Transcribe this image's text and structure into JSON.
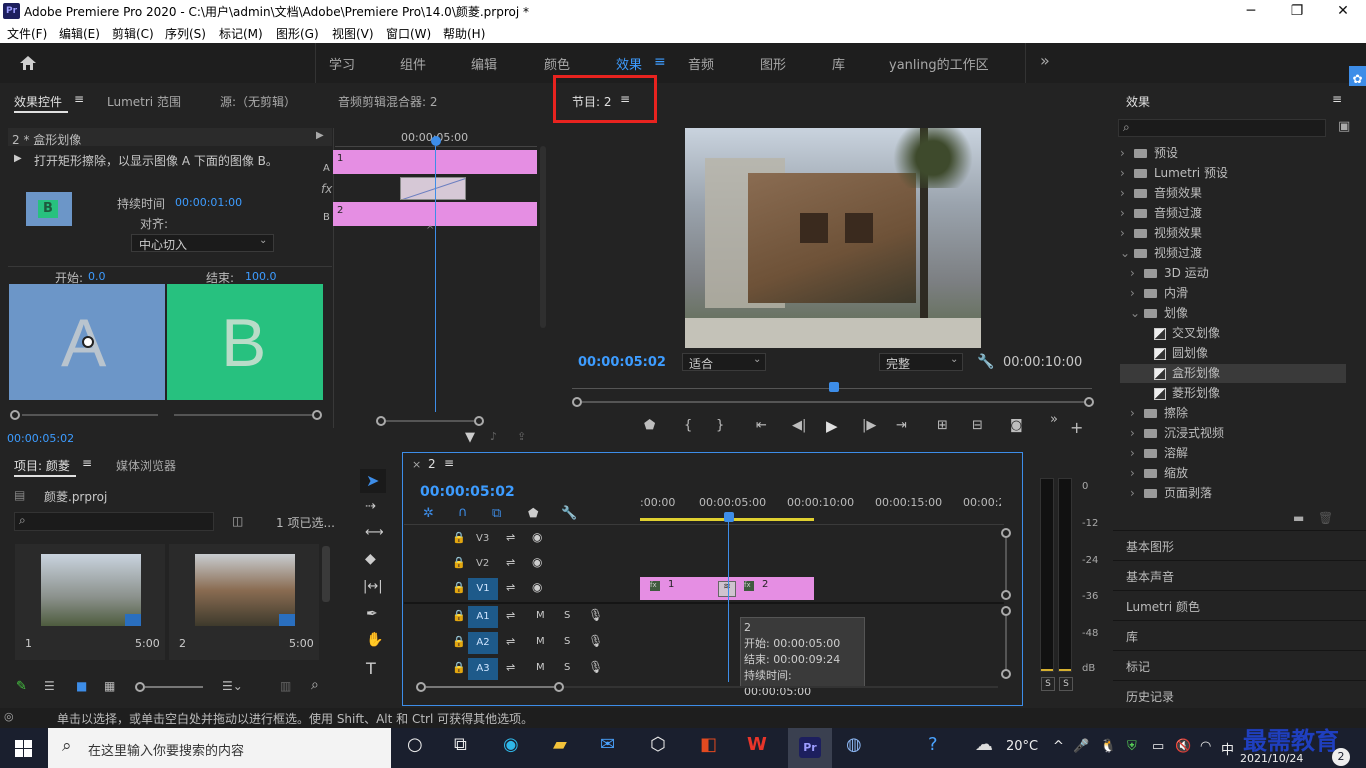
{
  "app": {
    "title": "Adobe Premiere Pro 2020 - C:\\用户\\admin\\文档\\Adobe\\Premiere Pro\\14.0\\颜菱.prproj *",
    "logo": "Pr",
    "window_buttons": [
      "─",
      "❐",
      "✕"
    ]
  },
  "menu": [
    "文件(F)",
    "编辑(E)",
    "剪辑(C)",
    "序列(S)",
    "标记(M)",
    "图形(G)",
    "视图(V)",
    "窗口(W)",
    "帮助(H)"
  ],
  "workspaces": {
    "tabs": [
      "学习",
      "组件",
      "编辑",
      "颜色",
      "效果",
      "音频",
      "图形",
      "库",
      "yanling的工作区"
    ],
    "active": "效果",
    "more": "»"
  },
  "effect_controls": {
    "tabs": [
      "效果控件",
      "Lumetri 范围",
      "源:（无剪辑）",
      "音频剪辑混合器: 2"
    ],
    "clip_header": "2 * 盒形划像",
    "description": "打开矩形擦除，以显示图像 A 下面的图像 B。",
    "duration_label": "持续时间",
    "duration_value": "00:00:01:00",
    "align_label": "对齐:",
    "align_value": "中心切入",
    "start_label": "开始:",
    "start_value": "0.0",
    "end_label": "结束:",
    "end_value": "100.0",
    "preview_a": "A",
    "preview_b": "B",
    "mini_timecode": "00:00:05:00",
    "track_a_label": "A",
    "track_b_label": "B",
    "track_a_clip": "1",
    "track_b_clip": "2",
    "fx_label": "fx",
    "timecode": "00:00:05:02"
  },
  "program": {
    "tab": "节目: 2",
    "timecode": "00:00:05:02",
    "fit_value": "适合",
    "quality_value": "完整",
    "duration": "00:00:10:00"
  },
  "effects_panel": {
    "title": "效果",
    "items": [
      {
        "level": 0,
        "kind": "folder",
        "label": "预设",
        "open": false
      },
      {
        "level": 0,
        "kind": "folder",
        "label": "Lumetri 预设",
        "open": false
      },
      {
        "level": 0,
        "kind": "folder",
        "label": "音频效果",
        "open": false
      },
      {
        "level": 0,
        "kind": "folder",
        "label": "音频过渡",
        "open": false
      },
      {
        "level": 0,
        "kind": "folder",
        "label": "视频效果",
        "open": false
      },
      {
        "level": 0,
        "kind": "folder",
        "label": "视频过渡",
        "open": true
      },
      {
        "level": 1,
        "kind": "folder",
        "label": "3D 运动",
        "open": false
      },
      {
        "level": 1,
        "kind": "folder",
        "label": "内滑",
        "open": false
      },
      {
        "level": 1,
        "kind": "folder",
        "label": "划像",
        "open": true
      },
      {
        "level": 2,
        "kind": "item",
        "label": "交叉划像"
      },
      {
        "level": 2,
        "kind": "item",
        "label": "圆划像"
      },
      {
        "level": 2,
        "kind": "item",
        "label": "盒形划像",
        "selected": true
      },
      {
        "level": 2,
        "kind": "item",
        "label": "菱形划像"
      },
      {
        "level": 1,
        "kind": "folder",
        "label": "擦除",
        "open": false
      },
      {
        "level": 1,
        "kind": "folder",
        "label": "沉浸式视频",
        "open": false
      },
      {
        "level": 1,
        "kind": "folder",
        "label": "溶解",
        "open": false
      },
      {
        "level": 1,
        "kind": "folder",
        "label": "缩放",
        "open": false
      },
      {
        "level": 1,
        "kind": "folder",
        "label": "页面剥落",
        "open": false
      }
    ],
    "sections": [
      "基本图形",
      "基本声音",
      "Lumetri 颜色",
      "库",
      "标记",
      "历史记录"
    ]
  },
  "project": {
    "tabs": [
      "项目: 颜菱",
      "媒体浏览器"
    ],
    "file": "颜菱.prproj",
    "selection": "1 项已选...",
    "items": [
      {
        "name": "1",
        "duration": "5:00"
      },
      {
        "name": "2",
        "duration": "5:00"
      }
    ]
  },
  "timeline": {
    "tab": "2",
    "timecode": "00:00:05:02",
    "ruler": [
      ":00:00",
      "00:00:05:00",
      "00:00:10:00",
      "00:00:15:00",
      "00:00:2"
    ],
    "video_tracks": [
      "V3",
      "V2",
      "V1"
    ],
    "audio_tracks": [
      "A1",
      "A2",
      "A3"
    ],
    "clip1": "1",
    "clip2": "2",
    "tooltip": {
      "name": "2",
      "start": "开始: 00:00:05:00",
      "end": "结束: 00:00:09:24",
      "duration": "持续时间: 00:00:05:00"
    },
    "mute_label": "M",
    "solo_label": "S"
  },
  "audio_meter": {
    "ticks": [
      "0",
      "-12",
      "-24",
      "-36",
      "-48",
      "dB"
    ],
    "solo": [
      "S",
      "S"
    ]
  },
  "status": "单击以选择，或单击空白处并拖动以进行框选。使用 Shift、Alt 和 Ctrl 可获得其他选项。",
  "taskbar": {
    "search_placeholder": "在这里输入你要搜索的内容",
    "weather": "20°C",
    "ime": "中",
    "date": "2021/10/24",
    "notification_count": "2",
    "watermark": "最需教育"
  },
  "colors": {
    "accent": "#3d9cff",
    "clip": "#e58ee3",
    "highlight_box": "#e8231f",
    "preview_a": "#6c96c8",
    "preview_b": "#27c17f"
  }
}
